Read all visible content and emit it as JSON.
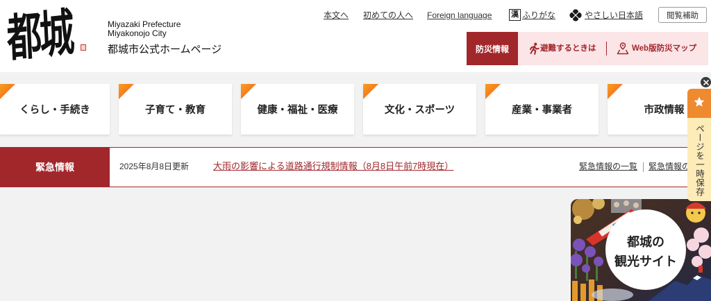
{
  "header": {
    "logo": {
      "calligraphy": "都城",
      "prefecture_en": "Miyazaki Prefecture",
      "city_en": "Miyakonojo City",
      "site_title": "都城市公式ホームページ"
    },
    "top_links": [
      {
        "label": "本文へ"
      },
      {
        "label": "初めての人へ"
      },
      {
        "label": "Foreign language"
      },
      {
        "label": "ふりがな",
        "icon": "kanji-icon",
        "icon_text": "漢"
      },
      {
        "label": "やさしい日本語",
        "icon": "clover-icon"
      }
    ],
    "accessibility_button": "閲覧補助",
    "disaster": {
      "label": "防災情報",
      "links": [
        {
          "label": "避難するときは",
          "icon": "evacuation-icon"
        },
        {
          "label": "Web版防災マップ",
          "icon": "map-pin-icon"
        }
      ]
    }
  },
  "nav": {
    "cards": [
      {
        "label": "くらし・手続き"
      },
      {
        "label": "子育て・教育"
      },
      {
        "label": "健康・福祉・医療"
      },
      {
        "label": "文化・スポーツ"
      },
      {
        "label": "産業・事業者"
      },
      {
        "label": "市政情報"
      }
    ]
  },
  "emergency": {
    "label": "緊急情報",
    "updated": "2025年8月8日更新",
    "headline": "大雨の影響による道路通行規制情報（8月8日午前7時現在）",
    "links": [
      {
        "label": "緊急情報の一覧"
      },
      {
        "label": "緊急情報の"
      }
    ]
  },
  "save_panel": {
    "label": "ページを一時保存",
    "icon": "star-icon",
    "close_icon": "close-icon"
  },
  "tourism_banner": {
    "line1": "都城の",
    "line2": "観光サイト"
  },
  "colors": {
    "accent_red": "#a2272b",
    "disaster_links_bg": "#fbe5e7",
    "nav_corner": "#f47920",
    "save_star_bg": "#ef8a2f",
    "save_tab_bg": "#fdebb8",
    "page_bg": "#f2f2f2"
  }
}
